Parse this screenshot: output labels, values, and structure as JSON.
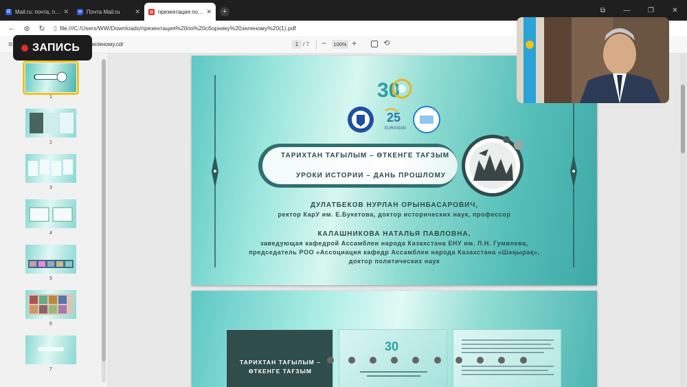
{
  "browser": {
    "tabs": [
      {
        "title": "Mail.ru: почта, поиск в интерне",
        "icon": "mailru-icon"
      },
      {
        "title": "Почта Mail.ru",
        "icon": "mail-icon"
      },
      {
        "title": "презентация по сборнику",
        "icon": "pdf-icon",
        "active": true
      }
    ],
    "url": "file:///C:/Users/WW/Downloads/презентация%20по%20сборнику%20зеленому%20(1).pdf"
  },
  "pdf_toolbar": {
    "filename": "зеленому.cdr",
    "current_page": "1",
    "total_pages": "/ 7",
    "zoom": "100%"
  },
  "recording": {
    "label": "ЗАПИСЬ",
    "color": "#e52a2a"
  },
  "thumbnails": [
    {
      "num": "1",
      "selected": true
    },
    {
      "num": "2"
    },
    {
      "num": "3"
    },
    {
      "num": "4"
    },
    {
      "num": "5"
    },
    {
      "num": "6"
    },
    {
      "num": "7"
    }
  ],
  "slide1": {
    "title_kz": "ТАРИХТАН ТАҒЫЛЫМ – ӨТКЕНГЕ ТАҒЗЫМ",
    "title_ru": "УРОКИ ИСТОРИИ – ДАНЬ ПРОШЛОМУ",
    "author1_name": "ДУЛАТБЕКОВ НУРЛАН ОРЫНБАСАРОВИЧ,",
    "author1_desc": "ректор КарУ им. Е.Букетова, доктор исторических наук, профессор",
    "author2_name": "КАЛАШНИКОВА НАТАЛЬЯ ПАВЛОВНА,",
    "author2_desc": [
      "заведующая кафедрой Ассамблеи народа Казахстана ЕНУ им. Л.Н. Гумилева,",
      "председатель РОО «Ассоциация кафедр Ассамблеи народа Казахстана «Шаңырақ»,",
      "доктор политических наук"
    ],
    "logo_text": "30"
  },
  "slide2": {
    "cover_line1": "ТАРИХТАН ТАҒЫЛЫМ –",
    "cover_line2": "ӨТКЕНГЕ ТАҒЗЫМ"
  }
}
